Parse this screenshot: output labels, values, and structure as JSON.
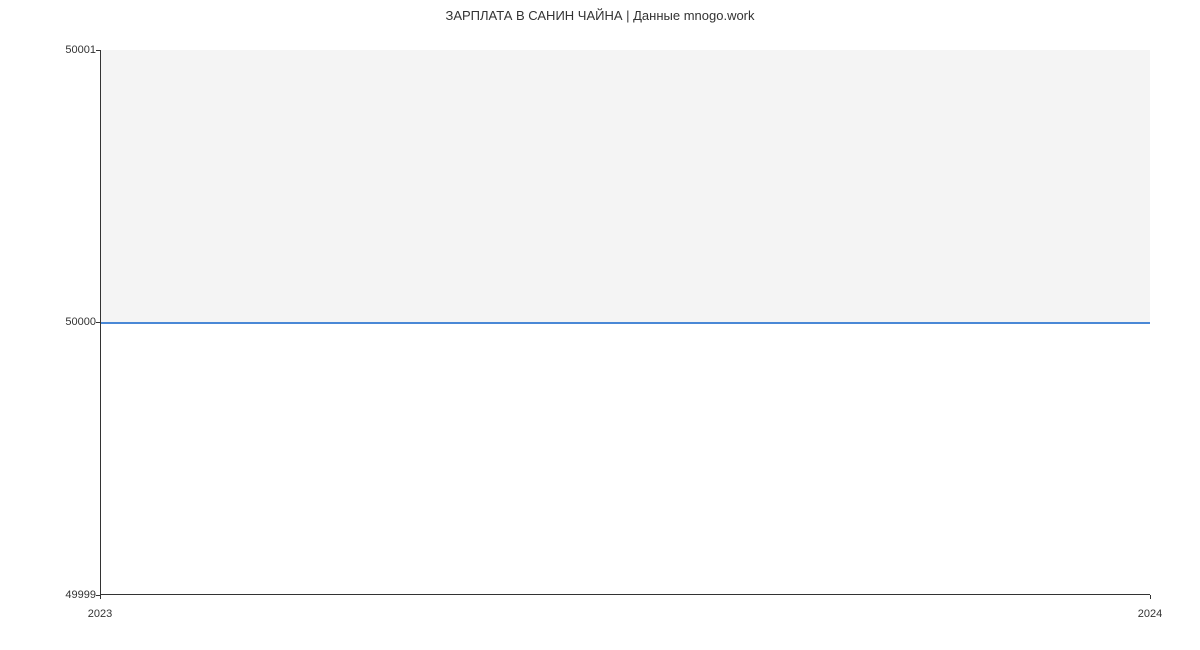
{
  "chart_data": {
    "type": "line",
    "title": "ЗАРПЛАТА В  САНИН ЧАЙНА | Данные mnogo.work",
    "x": [
      2023,
      2024
    ],
    "values": [
      50000,
      50000
    ],
    "y_ticks": [
      "50001",
      "50000",
      "49999"
    ],
    "x_ticks": [
      "2023",
      "2024"
    ],
    "xlabel": "",
    "ylabel": "",
    "ylim": [
      49999,
      50001
    ],
    "xlim": [
      2023,
      2024
    ]
  }
}
